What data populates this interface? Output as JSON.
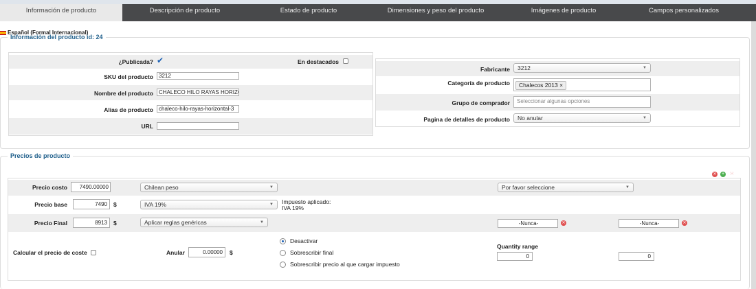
{
  "tabs": [
    {
      "label": "Información de producto",
      "active": true
    },
    {
      "label": "Descripción de producto",
      "active": false
    },
    {
      "label": "Estado de producto",
      "active": false
    },
    {
      "label": "Dimensiones y peso del producto",
      "active": false
    },
    {
      "label": "Imágenes de producto",
      "active": false
    },
    {
      "label": "Campos personalizados",
      "active": false
    }
  ],
  "language": "Español (Formal Internacional)",
  "info": {
    "legend": "Información del producto id: 24",
    "published_label": "¿Publicada?",
    "published_checked": true,
    "featured_label": "En destacados",
    "featured_checked": false,
    "sku_label": "SKU del producto",
    "sku_value": "3212",
    "name_label": "Nombre del producto",
    "name_value": "CHALECO HILO RAYAS HORIZONTAL",
    "alias_label": "Alias de producto",
    "alias_value": "chaleco-hilo-rayas-horizontal-3",
    "url_label": "URL",
    "url_value": "",
    "manufacturer_label": "Fabricante",
    "manufacturer_value": "3212",
    "category_label": "Categoría de producto",
    "category_tag": "Chalecos 2013",
    "shopper_label": "Grupo de comprador",
    "shopper_placeholder": "Seleccionar algunas opciones",
    "details_label": "Pagina de detalles de producto",
    "details_value": "No anular"
  },
  "prices": {
    "legend": "Precios de producto",
    "cost_label": "Precio costo",
    "cost_value": "7490.00000",
    "currency_value": "Chilean peso",
    "select_placeholder": "Por favor seleccione",
    "base_label": "Precio base",
    "base_value": "7490",
    "currency_symbol": "$",
    "tax_value": "IVA 19%",
    "tax_applied_label": "Impuesto aplicado:",
    "tax_applied_value": "IVA 19%",
    "final_label": "Precio Final",
    "final_value": "8913",
    "rules_value": "Aplicar reglas genéricas",
    "never_1": "-Nunca-",
    "never_2": "-Nunca-",
    "calc_cost_label": "Calcular el precio de coste",
    "override_label": "Anular",
    "override_value": "0.00000",
    "radio_deactivate": "Desactivar",
    "radio_overwrite_final": "Sobrescribir final",
    "radio_overwrite_tax": "Sobrescribir precio al que cargar impuesto",
    "quantity_range_label": "Quantity range",
    "qty_from": "0",
    "qty_to": "0"
  },
  "colors": {
    "tab_bar": "#48494b",
    "legend_text": "#1f5f8b",
    "row_shade": "#eeeeee"
  }
}
